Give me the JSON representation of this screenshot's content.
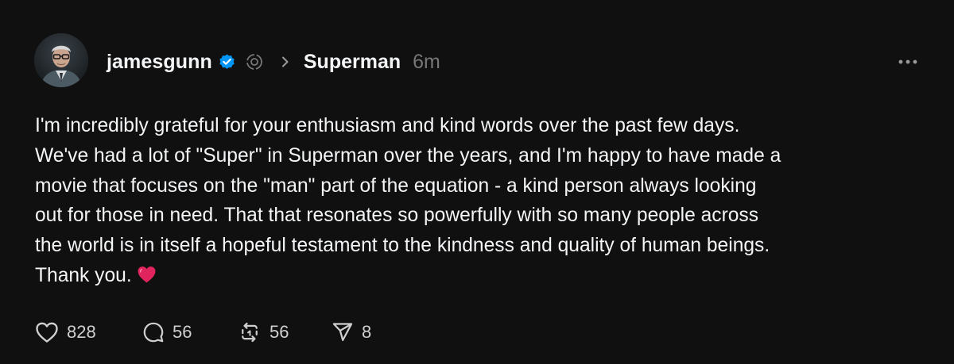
{
  "post": {
    "author": {
      "username": "jamesgunn",
      "verified": true
    },
    "topic": "Superman",
    "time": "6m",
    "body_lines": [
      "I'm incredibly grateful for your enthusiasm and kind words over the past few days.",
      "We've had a lot of \"Super\" in Superman over the years, and I'm happy to have made a",
      "movie that focuses on the \"man\" part of the equation - a kind person always looking",
      "out for those in need. That that resonates so powerfully with so many people across",
      "the world is in itself a hopeful testament to the kindness and quality of human beings.",
      "Thank you."
    ],
    "emoji": "red-heart-emoji",
    "stats": {
      "likes": "828",
      "replies": "56",
      "reposts": "56",
      "shares": "8"
    }
  },
  "icons": {
    "verified": "verified-badge-icon",
    "community": "community-icon",
    "chevron": "chevron-right-icon",
    "more": "more-options-icon",
    "like": "heart-icon",
    "reply": "comment-icon",
    "repost": "repost-icon",
    "share": "send-icon"
  },
  "colors": {
    "background": "#101010",
    "text": "#f3f5f7",
    "muted": "#777777",
    "verified_blue": "#0095f6",
    "heart_red": "#e0245e"
  }
}
